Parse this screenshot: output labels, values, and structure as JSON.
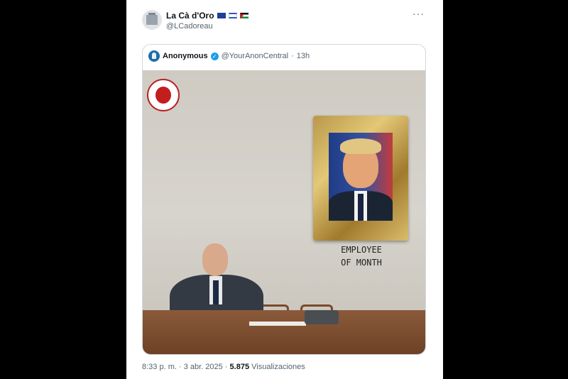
{
  "post": {
    "author_name": "La Cà d'Oro",
    "author_handle": "@LCadoreau",
    "flags": [
      "eu-flag",
      "israel-flag",
      "palestine-flag"
    ],
    "more_label": "···"
  },
  "quote": {
    "author_name": "Anonymous",
    "author_handle": "@YourAnonCentral",
    "separator": "·",
    "time_ago": "13h",
    "image_caption_line1": "EMPLOYEE",
    "image_caption_line2": "OF MONTH"
  },
  "footer": {
    "timestamp": "8:33 p. m. · 3 abr. 2025 ·",
    "views_count": "5.875",
    "views_label": "Visualizaciones"
  },
  "colors": {
    "background": "#000000",
    "card": "#ffffff",
    "verified": "#1d9bf0",
    "secondary_text": "#536471"
  }
}
